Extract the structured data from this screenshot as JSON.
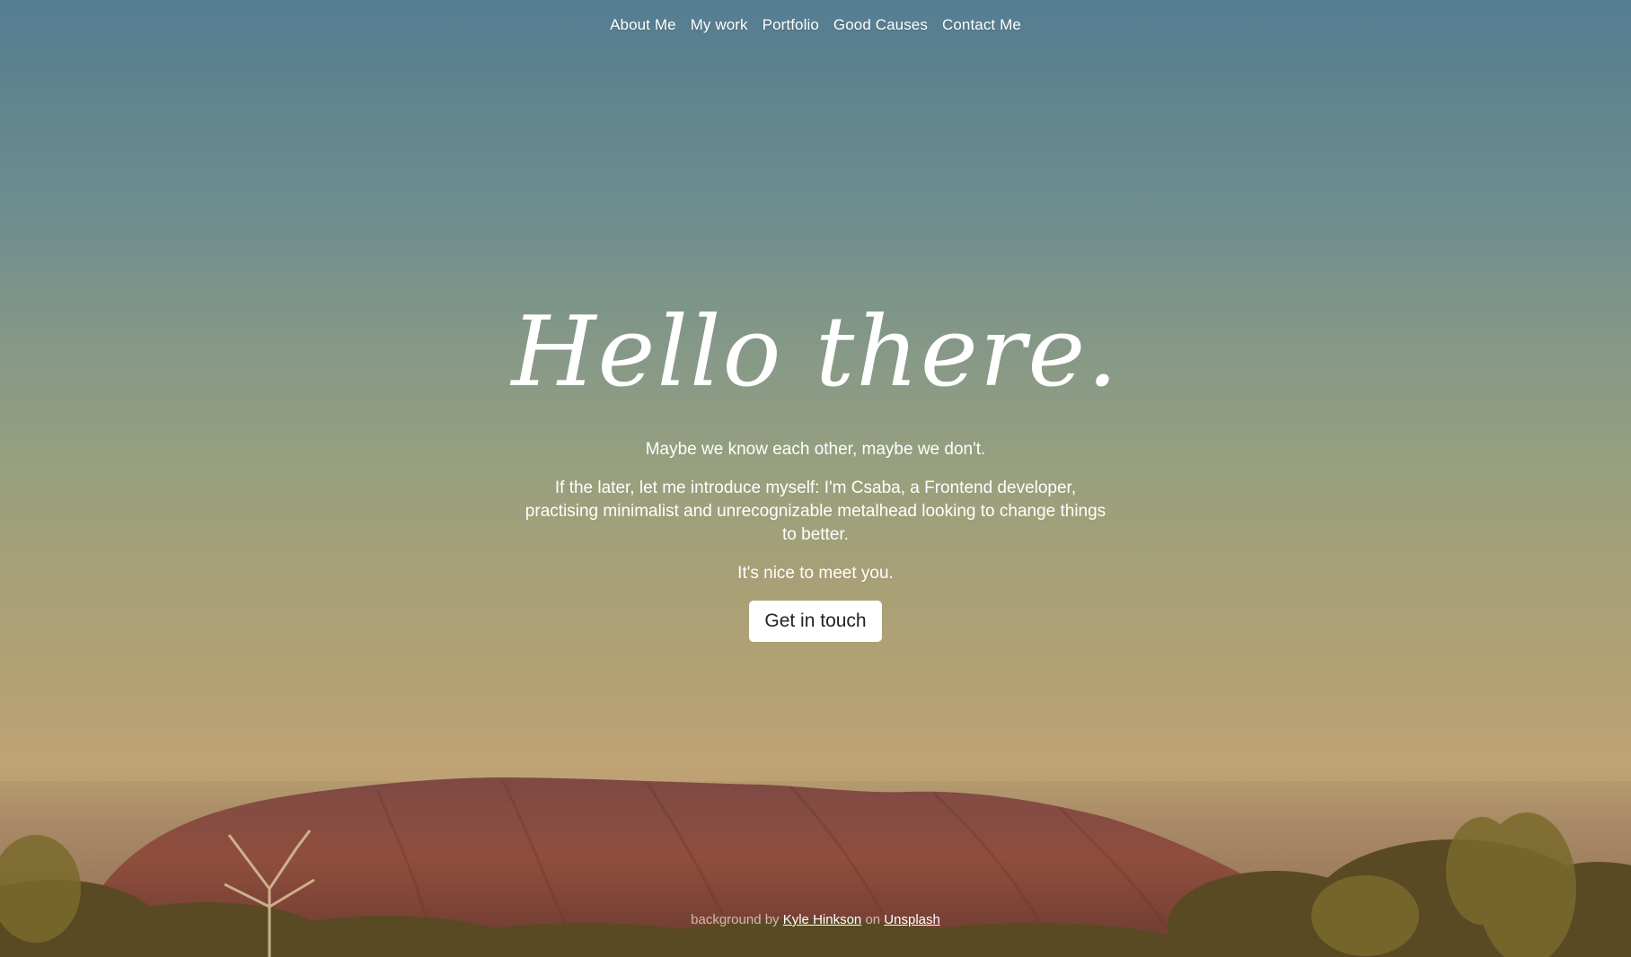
{
  "nav": {
    "items": [
      {
        "label": "About Me"
      },
      {
        "label": "My work"
      },
      {
        "label": "Portfolio"
      },
      {
        "label": "Good Causes"
      },
      {
        "label": "Contact Me"
      }
    ]
  },
  "hero": {
    "title": "Hello there.",
    "paragraphs": [
      "Maybe we know each other, maybe we don't.",
      "If the later, let me introduce myself: I'm Csaba, a Frontend developer, practising minimalist and unrecognizable metalhead looking to change things to better.",
      "It's nice to meet you."
    ],
    "cta_label": "Get in touch"
  },
  "credit": {
    "prefix": "background by",
    "author": "Kyle Hinkson",
    "middle": "on",
    "source": "Unsplash"
  },
  "colors": {
    "sky_top": "#557d92",
    "horizon": "#b9a173",
    "rock": "#8a4b3c",
    "cta_bg": "#ffffff",
    "cta_text": "#222222"
  }
}
